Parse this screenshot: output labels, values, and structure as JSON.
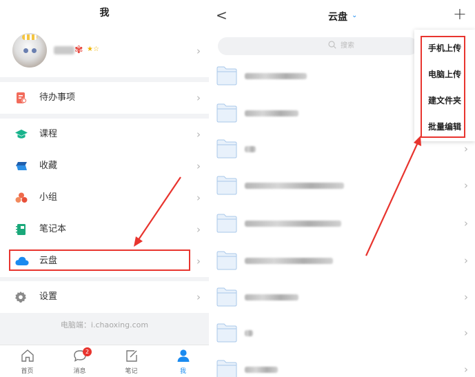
{
  "left": {
    "title": "我",
    "profile": {
      "flower_badge": "✾",
      "stars": "★☆"
    },
    "menu": [
      {
        "label": "待办事项",
        "icon": "todo-icon",
        "color": "#f26b5b"
      },
      {
        "label": "课程",
        "icon": "graduation-cap-icon",
        "color": "#18b38c"
      },
      {
        "label": "收藏",
        "icon": "bookmark-stack-icon",
        "color": "#2c7fd6"
      },
      {
        "label": "小组",
        "icon": "group-icon",
        "color": "#ef6a4b"
      },
      {
        "label": "笔记本",
        "icon": "notebook-icon",
        "color": "#1aa87a"
      },
      {
        "label": "云盘",
        "icon": "cloud-icon",
        "color": "#1a8bf0"
      },
      {
        "label": "设置",
        "icon": "gear-icon",
        "color": "#8a8a8a"
      }
    ],
    "footer_hint": "电脑端：i.chaoxing.com",
    "tabs": [
      {
        "label": "首页",
        "icon": "home-icon"
      },
      {
        "label": "消息",
        "icon": "message-icon",
        "badge": "2"
      },
      {
        "label": "笔记",
        "icon": "note-edit-icon"
      },
      {
        "label": "我",
        "icon": "user-icon",
        "active": true
      }
    ]
  },
  "right": {
    "back": "<",
    "title": "云盘",
    "title_chevron": "⌄",
    "add": "+",
    "search_placeholder": "搜索",
    "popup_menu": [
      "手机上传",
      "电脑上传",
      "建文件夹",
      "批量编辑"
    ]
  },
  "colors": {
    "accent": "#1a8bf0",
    "highlight": "#e8342e",
    "folder": "#cfe3f7"
  }
}
